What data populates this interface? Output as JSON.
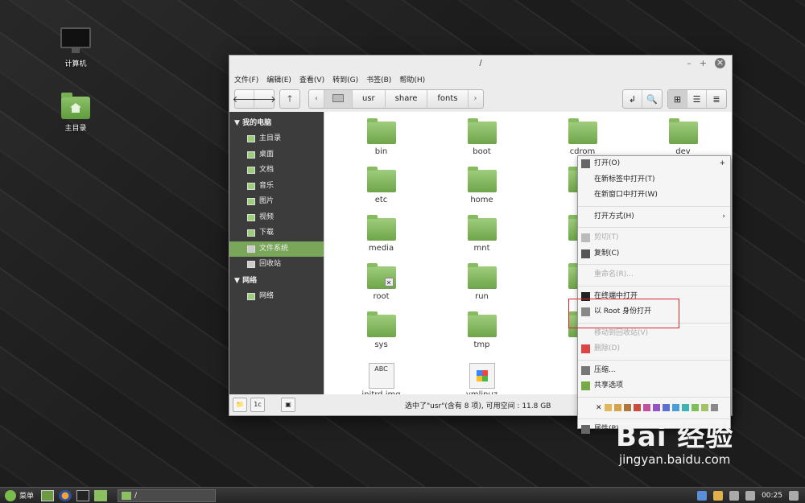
{
  "desktop": {
    "icons": [
      {
        "label": "计算机",
        "icon": "computer-icon"
      },
      {
        "label": "主目录",
        "icon": "home-folder-icon"
      }
    ]
  },
  "window": {
    "title": "/",
    "controls": {
      "minimize": "–",
      "maximize": "+",
      "close": "×"
    },
    "menu": [
      "文件(F)",
      "编辑(E)",
      "查看(V)",
      "转到(G)",
      "书签(B)",
      "帮助(H)"
    ],
    "toolbar": {
      "back": "🡐",
      "forward": "🡒",
      "up": "🡑",
      "path_left": "‹",
      "path_right": "›",
      "path": [
        "usr",
        "share",
        "fonts"
      ],
      "toggle_location": "↲",
      "search": "🔍",
      "views": [
        "⊞",
        "☰",
        "≣"
      ]
    },
    "sidebar": {
      "sections": [
        {
          "title": "我的电脑",
          "items": [
            "主目录",
            "桌面",
            "文档",
            "音乐",
            "图片",
            "视频",
            "下载",
            "文件系统",
            "回收站"
          ],
          "active": "文件系统"
        },
        {
          "title": "网络",
          "items": [
            "网络"
          ]
        }
      ]
    },
    "files": [
      {
        "name": "bin",
        "type": "folder"
      },
      {
        "name": "boot",
        "type": "folder"
      },
      {
        "name": "cdrom",
        "type": "folder"
      },
      {
        "name": "dev",
        "type": "folder"
      },
      {
        "name": "etc",
        "type": "folder"
      },
      {
        "name": "home",
        "type": "folder"
      },
      {
        "name": "l",
        "type": "folder"
      },
      {
        "name": "",
        "type": "hidden"
      },
      {
        "name": "media",
        "type": "folder"
      },
      {
        "name": "mnt",
        "type": "folder"
      },
      {
        "name": "o",
        "type": "folder"
      },
      {
        "name": "",
        "type": "hidden"
      },
      {
        "name": "root",
        "type": "folder-locked"
      },
      {
        "name": "run",
        "type": "folder"
      },
      {
        "name": "s",
        "type": "folder"
      },
      {
        "name": "",
        "type": "hidden"
      },
      {
        "name": "sys",
        "type": "folder"
      },
      {
        "name": "tmp",
        "type": "folder"
      },
      {
        "name": "",
        "type": "folder"
      },
      {
        "name": "",
        "type": "hidden"
      },
      {
        "name": "initrd.img",
        "type": "file-abc"
      },
      {
        "name": "vmlinuz",
        "type": "file-win"
      }
    ],
    "status": "选中了\"usr\"(含有 8 项), 可用空间 : 11.8 GB",
    "statusbar_buttons": [
      "📁",
      "1c",
      "▣"
    ]
  },
  "context_menu": {
    "items": [
      {
        "label": "打开(O)",
        "icon": "open-icon",
        "extra": "+"
      },
      {
        "label": "在新标签中打开(T)"
      },
      {
        "label": "在新窗口中打开(W)"
      },
      {
        "sep": true
      },
      {
        "label": "打开方式(H)",
        "extra": "›"
      },
      {
        "sep": true
      },
      {
        "label": "剪切(T)",
        "disabled": true,
        "icon": "cut-icon"
      },
      {
        "label": "复制(C)",
        "icon": "copy-icon"
      },
      {
        "sep": true
      },
      {
        "label": "重命名(R)...",
        "disabled": true
      },
      {
        "sep": true
      },
      {
        "label": "在终端中打开",
        "icon": "terminal-icon"
      },
      {
        "label": "以 Root 身份打开",
        "icon": "root-icon"
      },
      {
        "sep": true
      },
      {
        "label": "移动到回收站(V)",
        "disabled": true
      },
      {
        "label": "删除(D)",
        "disabled": true,
        "icon": "delete-icon"
      },
      {
        "sep": true
      },
      {
        "label": "压缩...",
        "icon": "compress-icon"
      },
      {
        "label": "共享选项",
        "icon": "share-icon"
      },
      {
        "sep": true
      },
      {
        "swatches": true
      },
      {
        "sep": true
      },
      {
        "label": "属性(P)",
        "icon": "properties-icon"
      }
    ],
    "swatch_colors": [
      "#e0b75c",
      "#d8a24a",
      "#b0783a",
      "#c94c3c",
      "#c2509a",
      "#9452c7",
      "#5b6fd1",
      "#4a9ed8",
      "#3fb3b0",
      "#7fbf59",
      "#a3c268",
      "#8a8a8a"
    ]
  },
  "taskbar": {
    "menu_label": "菜单",
    "task_label": "/",
    "time": "00:25"
  },
  "watermark": {
    "brand": "Bai 经验",
    "url": "jingyan.baidu.com"
  }
}
